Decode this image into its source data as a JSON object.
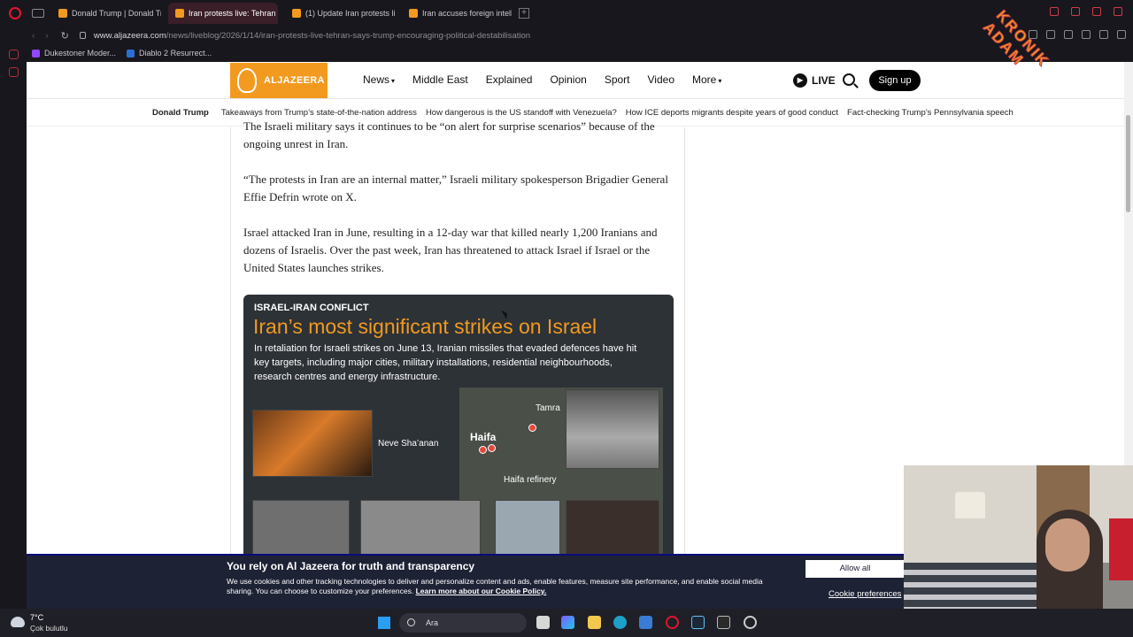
{
  "browser": {
    "tabs": [
      {
        "title": "Donald Trump | Donald Tru",
        "active": false
      },
      {
        "title": "Iran protests live: Tehran s",
        "active": true
      },
      {
        "title": "(1) Update Iran protests liv",
        "active": false
      },
      {
        "title": "Iran accuses foreign intelli",
        "active": false
      }
    ],
    "url_host": "www.aljazeera.com",
    "url_path": "/news/liveblog/2026/1/14/iran-protests-live-tehran-says-trump-encouraging-political-destabilisation",
    "bookmarks": [
      "Dukestoner Moder...",
      "Diablo 2 Resurrect..."
    ]
  },
  "site": {
    "logo_text": "ALJAZEERA",
    "nav": [
      {
        "label": "News",
        "dropdown": true
      },
      {
        "label": "Middle East",
        "dropdown": false
      },
      {
        "label": "Explained",
        "dropdown": false
      },
      {
        "label": "Opinion",
        "dropdown": false
      },
      {
        "label": "Sport",
        "dropdown": false
      },
      {
        "label": "Video",
        "dropdown": false
      },
      {
        "label": "More",
        "dropdown": true
      }
    ],
    "live_label": "LIVE",
    "signup_label": "Sign up",
    "topics_lead": "Donald Trump",
    "topics": [
      "Takeaways from Trump’s state-of-the-nation address",
      "How dangerous is the US standoff with Venezuela?",
      "How ICE deports migrants despite years of good conduct",
      "Fact-checking Trump’s Pennsylvania speech"
    ]
  },
  "article": {
    "para_cut": "The Israeli military says it continues to be “on alert for surprise scenarios” because of the ongoing unrest in Iran.",
    "para_quote": "“The protests in Iran are an internal matter,” Israeli military spokesperson Brigadier General Effie Defrin wrote on X.",
    "para_context": "Israel attacked Iran in June, resulting in a 12-day war that killed nearly 1,200 Iranians and dozens of Israelis. Over the past week, Iran has threatened to attack Israel if Israel or the United States launches strikes."
  },
  "infographic": {
    "kicker": "ISRAEL-IRAN CONFLICT",
    "title": "Iran’s most significant strikes on Israel",
    "body": "In retaliation for Israeli strikes on June 13, Iranian missiles that evaded defences have hit key targets, including major cities, military installations, residential neighbourhoods, research centres and energy infrastructure.",
    "labels": {
      "tamra": "Tamra",
      "haifa": "Haifa",
      "neve": "Neve Sha’anan",
      "refinery": "Haifa refinery"
    }
  },
  "cookie": {
    "title": "You rely on Al Jazeera for truth and transparency",
    "text": "We use cookies and other tracking technologies to deliver and personalize content and ads, enable features, measure site performance, and enable social media sharing. You can choose to customize your preferences.",
    "link": "Learn more about our Cookie Policy.",
    "allow": "Allow all",
    "prefs": "Cookie preferences"
  },
  "watermark": "KRONIK ADAM",
  "taskbar": {
    "temp": "7°C",
    "weather": "Çok bulutlu",
    "search": "Ara"
  },
  "colors": {
    "brand_orange": "#f29a1f",
    "opera_red": "#e0152f",
    "cookie_bg": "#1e2235"
  }
}
